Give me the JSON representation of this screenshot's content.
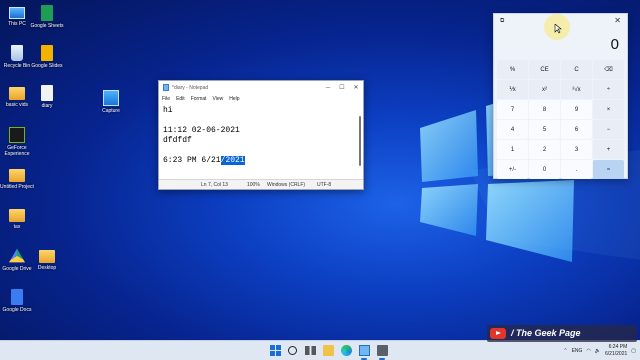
{
  "desktop": {
    "icons": [
      {
        "label": "This PC",
        "icon": "computer-icon"
      },
      {
        "label": "Google Sheets",
        "icon": "google-sheets-icon"
      },
      {
        "label": "Recycle Bin",
        "icon": "recycle-bin-icon"
      },
      {
        "label": "Google Slides",
        "icon": "google-slides-icon"
      },
      {
        "label": "basic vids",
        "icon": "folder-icon"
      },
      {
        "label": "diary",
        "icon": "text-file-icon"
      },
      {
        "label": "Capture",
        "icon": "image-file-icon"
      },
      {
        "label": "GeForce Experience",
        "icon": "geforce-icon"
      },
      {
        "label": "Untitled Project",
        "icon": "folder-icon"
      },
      {
        "label": "tax",
        "icon": "folder-icon"
      },
      {
        "label": "Google Drive",
        "icon": "google-drive-icon"
      },
      {
        "label": "Desktop",
        "icon": "folder-icon"
      },
      {
        "label": "Google Docs",
        "icon": "google-docs-icon"
      }
    ]
  },
  "notepad": {
    "title": "*diary - Notepad",
    "menu": [
      "File",
      "Edit",
      "Format",
      "View",
      "Help"
    ],
    "lines": [
      {
        "text": "hi"
      },
      {
        "text": ""
      },
      {
        "text": "11:12 02-06-2021"
      },
      {
        "text": "dfdfdf"
      },
      {
        "text": ""
      },
      {
        "before": "6:23 PM 6/21",
        "selected": "/2021"
      }
    ],
    "status": {
      "position": "Ln 7, Col 13",
      "zoom": "100%",
      "line_ending": "Windows (CRLF)",
      "encoding": "UTF-8"
    }
  },
  "calculator": {
    "display": "0",
    "keys": [
      "%",
      "CE",
      "C",
      "⌫",
      "⅟x",
      "x²",
      "²√x",
      "÷",
      "7",
      "8",
      "9",
      "×",
      "4",
      "5",
      "6",
      "−",
      "1",
      "2",
      "3",
      "+",
      "+/-",
      "0",
      ".",
      "="
    ]
  },
  "taskbar": {
    "apps": [
      "start-icon",
      "search-icon",
      "task-view-icon",
      "file-explorer-icon",
      "edge-icon",
      "notepad-icon",
      "calculator-icon"
    ],
    "language": "ENG",
    "time": "6:24 PM",
    "date": "6/21/2021"
  },
  "watermark": {
    "text": "The Geek Page"
  },
  "colors": {
    "accent": "#0a64d8",
    "wallpaper": "#0c3fc2",
    "calc_equals": "#b9d3f2"
  }
}
